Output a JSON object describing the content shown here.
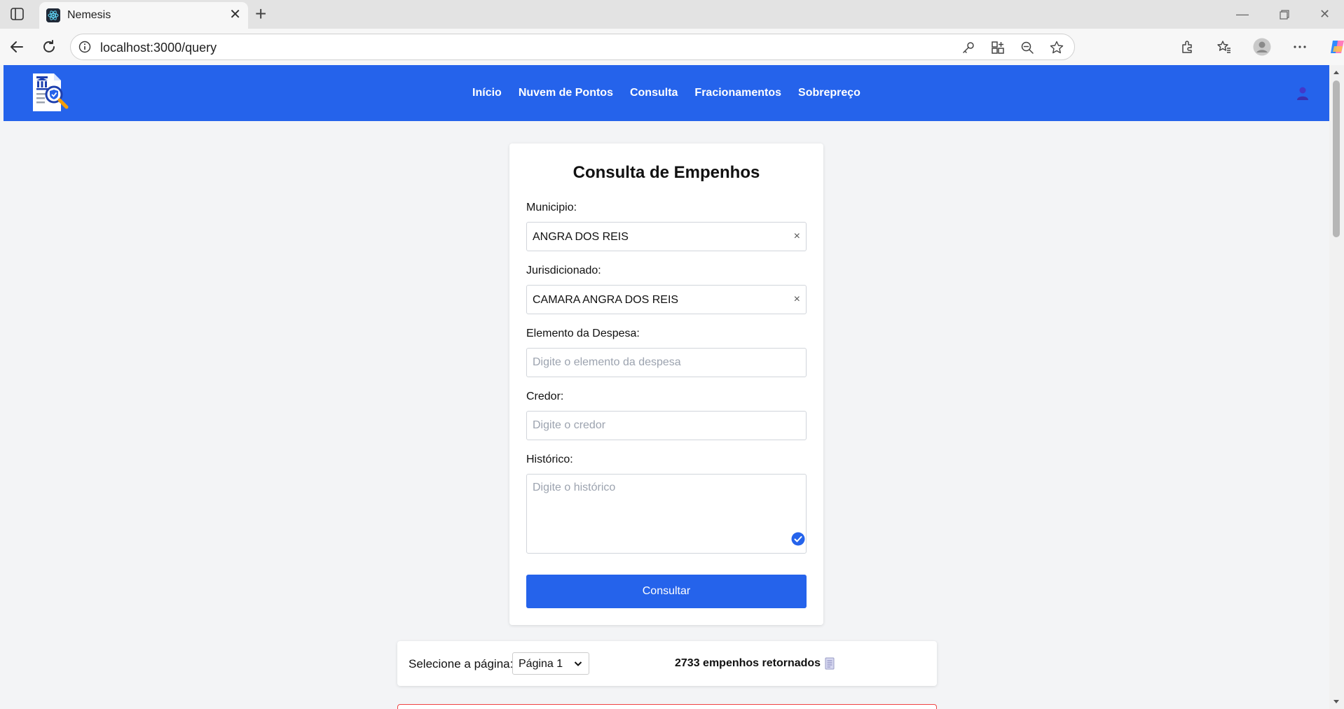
{
  "browser": {
    "tab_title": "Nemesis",
    "url": "localhost:3000/query"
  },
  "header": {
    "nav": [
      "Início",
      "Nuvem de Pontos",
      "Consulta",
      "Fracionamentos",
      "Sobrepreço"
    ]
  },
  "form": {
    "title": "Consulta de Empenhos",
    "municipio_label": "Municipio:",
    "municipio_value": "ANGRA DOS REIS",
    "jurisdicionado_label": "Jurisdicionado:",
    "jurisdicionado_value": "CAMARA ANGRA DOS REIS",
    "elemento_label": "Elemento da Despesa:",
    "elemento_placeholder": "Digite o elemento da despesa",
    "credor_label": "Credor:",
    "credor_placeholder": "Digite o credor",
    "historico_label": "Histórico:",
    "historico_placeholder": "Digite o histórico",
    "submit_label": "Consultar",
    "clear_symbol": "×"
  },
  "pager": {
    "label": "Selecione a página:",
    "selected_page": "Página 1",
    "results_text": "2733 empenhos retornados"
  },
  "colors": {
    "primary": "#2563eb",
    "background": "#f3f4f6",
    "error_border": "#ef4444"
  }
}
